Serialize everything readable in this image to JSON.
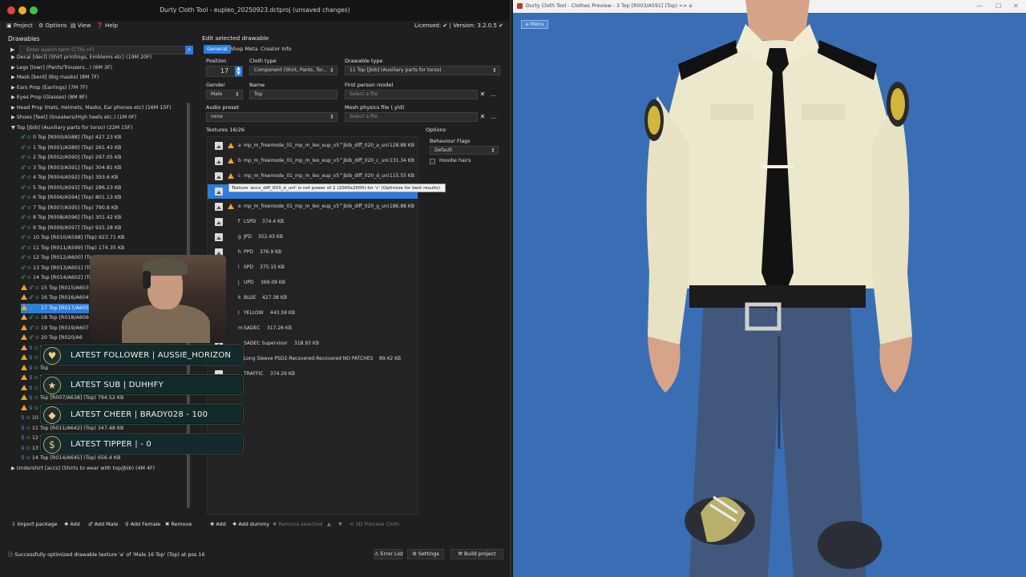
{
  "window": {
    "title": "Durty Cloth Tool - eupleo_20250923.dctproj (unsaved changes)",
    "license": "Licensed: ✔ | Version: 3.2.0.5 ✔"
  },
  "menu": {
    "project": "Project",
    "options": "Options",
    "view": "View",
    "help": "Help"
  },
  "drawables": {
    "label": "Drawables",
    "search_placeholder": "Enter search term (CTRL+F)",
    "rows": [
      "Decal [decl] (Shirt printings, Emblems etc) (19M 20F)",
      "Legs [lowr] (Pants/Trousers...) (6M 3F)",
      "Mask [berd] (Big masks) (8M 7F)",
      "Ears Prop (Earrings) (7M 7F)",
      "Eyes Prop (Glasses) (8M 8F)",
      "Head Prop (Hats, Helmets, Masks, Ear phones etc) (16M 15F)",
      "Shoes [feet] (Sneakers/High heels etc.) (1M 0F)",
      "Top [jbib] (Auxiliary parts for torso) (22M 15F)",
      "0 Top [R000/A588] (Top)  427.23 KB",
      "1 Top [R001/A589] (Top)  261.43 KB",
      "2 Top [R002/A590] (Top)  297.05 KB",
      "3 Top [R003/A591] (Top)  304.81 KB",
      "4 Top [R004/A592] (Top)  393.6 KB",
      "5 Top [R005/A593] (Top)  286.23 KB",
      "6 Top [R006/A594] (Top)  801.13 KB",
      "7 Top [R007/A595] (Top)  790.8 KB",
      "8 Top [R008/A596] (Top)  301.42 KB",
      "9 Top [R009/A597] (Top)  925.28 KB",
      "10 Top [R010/A598] (Top)  923.71 KB",
      "11 Top [R011/A599] (Top)  174.35 KB",
      "12 Top [R012/A600] (Top)  191.76 KB",
      "13 Top [R013/A601] (Top)  324.13 KB",
      "14 Top [R014/A602] (Top)  341.43 KB",
      "15 Top [R015/A603",
      "16 Top [R016/A604",
      "17 Top [R017/A605",
      "18 Top [R018/A606",
      "19 Top [R019/A607",
      "20 Top [R020/A6",
      "Top [R00",
      "Top [R001/A633] (Top)  273.98 KB",
      "Top",
      "Top",
      "Top",
      "Top [R007/A638] (Top)  794.52 KB",
      "Top",
      "10 Top [R010/A641] (Top)  329.33 KB",
      "11 Top [R011/A642] (Top)  347.48 KB",
      "12 Top [R012/A643] (Top)  2.33 MB",
      "13 Top [R013/A644] (Top)  639.24 KB",
      "14 Top [R014/A645] (Top)  656.4 KB",
      "Undershirt [accs] (Shirts to wear with top/jbib) (4M 4F)"
    ],
    "footer": {
      "import": "Import package",
      "add": "Add",
      "add_male": "Add Male",
      "add_female": "Add Female",
      "remove": "Remove"
    }
  },
  "edit": {
    "label": "Edit selected drawable",
    "tabs": [
      "General",
      "Shop Meta",
      "Creator Info"
    ],
    "position_label": "Position",
    "position_value": "17",
    "cloth_type_label": "Cloth type",
    "cloth_type_value": "Component (Shirt, Pants, Tor...",
    "drawable_type_label": "Drawable type",
    "drawable_type_value": "11  Top [jbib] (Auxiliary parts for torso)",
    "gender_label": "Gender",
    "gender_value": "Male",
    "name_label": "Name",
    "name_value": "Top",
    "first_person_label": "First person model",
    "first_person_placeholder": "Select a file",
    "audio_label": "Audio preset",
    "audio_value": "none",
    "mesh_label": "Mesh physics file (.yld)",
    "mesh_placeholder": "Select a file",
    "textures_label": "Textures 16/26",
    "textures": [
      {
        "letter": "a",
        "name": "mp_m_freemode_01_mp_m_leo_eup_v5^jbib_diff_020_a_uni",
        "size": "128.88 KB",
        "warn": true
      },
      {
        "letter": "b",
        "name": "mp_m_freemode_01_mp_m_leo_eup_v5^jbib_diff_020_c_uni",
        "size": "131.34 KB",
        "warn": true
      },
      {
        "letter": "c",
        "name": "mp_m_freemode_01_mp_m_leo_eup_v5^jbib_diff_020_d_uni",
        "size": "115.55 KB",
        "warn": true
      },
      {
        "letter": "",
        "name": "",
        "size": "",
        "warn": false
      },
      {
        "letter": "e",
        "name": "mp_m_freemode_01_mp_m_leo_eup_v5^jbib_diff_020_g_uni",
        "size": "186.88 KB",
        "warn": true
      },
      {
        "letter": "f",
        "name": "LSPD",
        "size": "374.4 KB",
        "warn": false
      },
      {
        "letter": "g",
        "name": "JPD",
        "size": "352.43 KB",
        "warn": false
      },
      {
        "letter": "h",
        "name": "PPD",
        "size": "376.9 KB",
        "warn": false
      },
      {
        "letter": "i",
        "name": "SPD",
        "size": "375.15 KB",
        "warn": false
      },
      {
        "letter": "j",
        "name": "UPD",
        "size": "369.09 KB",
        "warn": false
      },
      {
        "letter": "k",
        "name": "BLUE",
        "size": "427.38 KB",
        "warn": false
      },
      {
        "letter": "l",
        "name": "YELLOW",
        "size": "443.59 KB",
        "warn": false
      },
      {
        "letter": "m",
        "name": "SADEC",
        "size": "317.26 KB",
        "warn": false
      },
      {
        "letter": "",
        "name": "SADEC Supervisor",
        "size": "318.93 KB",
        "warn": false
      },
      {
        "letter": "",
        "name": "Long Sleeve PSD2-Recovered-Recovered NO PATCHES",
        "size": "89.42 KB",
        "warn": false
      },
      {
        "letter": "",
        "name": "TRAFFIC",
        "size": "374.29 KB",
        "warn": false
      }
    ],
    "tooltip": "Texture 'accs_diff_003_d_uni' is not power of 2 (2000x2000) for 'c' (Optimize for best results)",
    "options_label": "Options",
    "behaviour_label": "Behaviour Flags",
    "behaviour_value": "Default",
    "hoodie_label": "Hoodie hairs",
    "footer": {
      "add": "Add",
      "add_dummy": "Add dummy",
      "remove_selected": "Remove selected",
      "preview": "3D Preview Cloth"
    }
  },
  "status": {
    "text": "Successfully optimized drawable texture 'a' of 'Male 16 Top' (Top) at pos 16",
    "error_list": "Error List",
    "settings": "Settings",
    "build": "Build project"
  },
  "stream": {
    "alerts": [
      {
        "text": "LATEST FOLLOWER | AUSSIE_HORIZON",
        "icon": "heart-icon",
        "glyph": "♥"
      },
      {
        "text": "LATEST SUB | DUHHFY",
        "icon": "star-icon",
        "glyph": "★"
      },
      {
        "text": "LATEST CHEER | BRADY028 - 100",
        "icon": "diamond-icon",
        "glyph": "◆"
      },
      {
        "text": "LATEST TIPPER |  -  0",
        "icon": "dollar-icon",
        "glyph": "$"
      }
    ]
  },
  "preview": {
    "title": "Durty Cloth Tool - Clothes Preview - 3 Top [R003/A591] (Top) => a",
    "menu": "≡ Menu"
  },
  "colors": {
    "accent": "#2a7de1",
    "warning": "#e8a33b",
    "viewport_bg": "#3a6eb4"
  }
}
